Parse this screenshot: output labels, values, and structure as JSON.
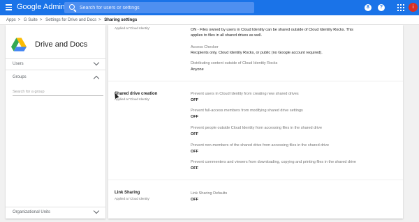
{
  "topbar": {
    "brand": "Google Admin",
    "search_placeholder": "Search for users or settings",
    "icons": [
      "menu-icon",
      "search-icon",
      "support-icon",
      "help-icon",
      "apps-icon"
    ],
    "support_glyph": "8",
    "help_glyph": "?",
    "avatar_initial": "i",
    "accent_color": "#1a73e8",
    "avatar_color": "#d93025"
  },
  "breadcrumb": {
    "items": [
      "Apps",
      "G Suite",
      "Settings for Drive and Docs",
      "Sharing settings"
    ],
    "separator": ">"
  },
  "sidebar": {
    "app_title": "Drive and Docs",
    "sections": {
      "users": "Users",
      "groups": "Groups",
      "org_units": "Organizational Units"
    },
    "group_search_placeholder": "Search for a group"
  },
  "main": {
    "top_row": {
      "subtitle": "Applied at 'Cloud Identity'",
      "sharing_text": "ON - Files owned by users in Cloud Identity can be shared outside of Cloud Identity Rocks. This applies to files in all shared drives as well.",
      "access_checker_label": "Access Checker",
      "access_checker_value": "Recipients only, Cloud Identity Rocks, or public (no Google account required).",
      "distributing_label": "Distributing content outside of Cloud Identity Rocks",
      "distributing_value": "Anyone"
    },
    "shared_drive": {
      "title": "Shared drive creation",
      "subtitle": "Applied at 'Cloud Identity'",
      "settings": [
        {
          "label": "Prevent users in Cloud Identity from creating new shared drives",
          "value": "OFF"
        },
        {
          "label": "Prevent full-access members from modifying shared drive settings",
          "value": "OFF"
        },
        {
          "label": "Prevent people outside Cloud Identity from accessing files in the shared drive",
          "value": "OFF"
        },
        {
          "label": "Prevent non-members of the shared drive from accessing files in the shared drive",
          "value": "OFF"
        },
        {
          "label": "Prevent commenters and viewers from downloading, copying and printing files in the shared drive",
          "value": "OFF"
        }
      ]
    },
    "link_sharing": {
      "title": "Link Sharing",
      "subtitle": "Applied at 'Cloud Identity'",
      "label": "Link Sharing Defaults",
      "value": "OFF"
    }
  }
}
